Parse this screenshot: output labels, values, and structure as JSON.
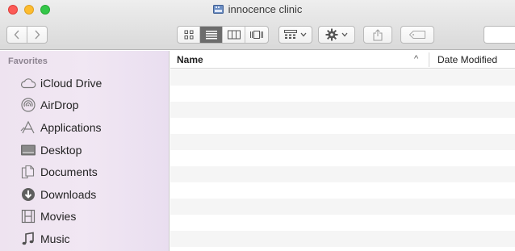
{
  "window": {
    "title": "innocence clinic",
    "title_icon": "external-disk-icon"
  },
  "toolbar": {
    "back_icon": "chevron-left-icon",
    "forward_icon": "chevron-right-icon",
    "view_modes": [
      "icon-view-icon",
      "list-view-icon",
      "column-view-icon",
      "coverflow-view-icon"
    ],
    "active_view": "list-view-icon",
    "arrange_icon": "arrange-grid-icon",
    "action_icon": "gear-icon",
    "share_icon": "share-icon",
    "tags_icon": "tag-icon"
  },
  "sidebar": {
    "heading": "Favorites",
    "items": [
      {
        "label": "iCloud Drive",
        "icon": "cloud-icon"
      },
      {
        "label": "AirDrop",
        "icon": "airdrop-icon"
      },
      {
        "label": "Applications",
        "icon": "applications-icon"
      },
      {
        "label": "Desktop",
        "icon": "desktop-icon"
      },
      {
        "label": "Documents",
        "icon": "documents-icon"
      },
      {
        "label": "Downloads",
        "icon": "downloads-icon"
      },
      {
        "label": "Movies",
        "icon": "movies-icon"
      },
      {
        "label": "Music",
        "icon": "music-icon"
      }
    ]
  },
  "file_list": {
    "columns": [
      {
        "label": "Name",
        "sorted": "ascending"
      },
      {
        "label": "Date Modified"
      }
    ],
    "sort_indicator": "^",
    "rows": []
  },
  "colors": {
    "sidebar_bg": "#efe4f1",
    "active_segment": "#6c6c6c",
    "close": "#fc5b57",
    "minimize": "#fdbc2e",
    "zoom": "#33c748"
  }
}
